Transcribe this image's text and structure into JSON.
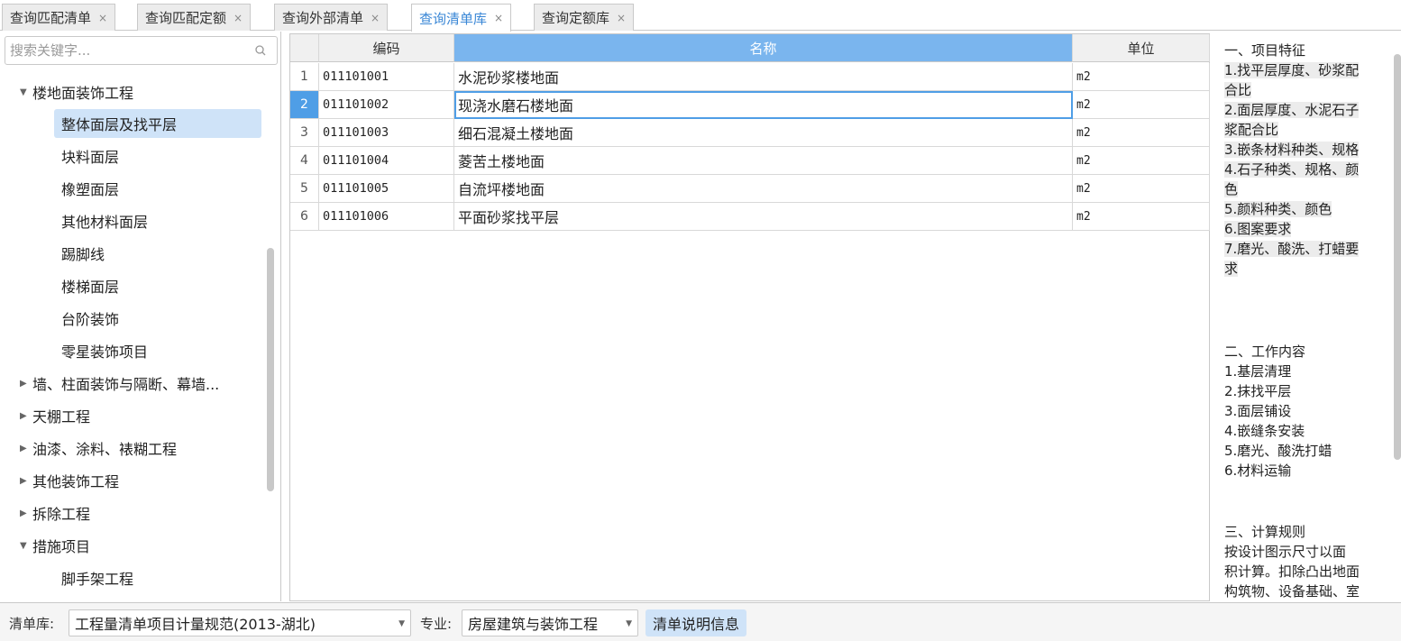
{
  "tabs": [
    {
      "label": "查询匹配清单",
      "active": false
    },
    {
      "label": "查询匹配定额",
      "active": false
    },
    {
      "label": "查询外部清单",
      "active": false
    },
    {
      "label": "查询清单库",
      "active": true
    },
    {
      "label": "查询定额库",
      "active": false
    }
  ],
  "close_glyph": "×",
  "search": {
    "placeholder": "搜索关键字..."
  },
  "tree": [
    {
      "label": "楼地面装饰工程",
      "expanded": true
    },
    {
      "label": "整体面层及找平层",
      "selected": true
    },
    {
      "label": "块料面层"
    },
    {
      "label": "橡塑面层"
    },
    {
      "label": "其他材料面层"
    },
    {
      "label": "踢脚线"
    },
    {
      "label": "楼梯面层"
    },
    {
      "label": "台阶装饰"
    },
    {
      "label": "零星装饰项目"
    },
    {
      "label": "墙、柱面装饰与隔断、幕墙...",
      "expanded": false
    },
    {
      "label": "天棚工程",
      "expanded": false
    },
    {
      "label": "油漆、涂料、裱糊工程",
      "expanded": false
    },
    {
      "label": "其他装饰工程",
      "expanded": false
    },
    {
      "label": "拆除工程",
      "expanded": false
    },
    {
      "label": "措施项目",
      "expanded": true
    },
    {
      "label": "脚手架工程"
    }
  ],
  "caret_expanded": "▼",
  "caret_collapsed": "▶",
  "grid": {
    "headers": {
      "code": "编码",
      "name": "名称",
      "unit": "单位"
    },
    "rows": [
      {
        "num": "1",
        "code": "011101001",
        "name": "水泥砂浆楼地面",
        "unit": "m2"
      },
      {
        "num": "2",
        "code": "011101002",
        "name": "现浇水磨石楼地面",
        "unit": "m2"
      },
      {
        "num": "3",
        "code": "011101003",
        "name": "细石混凝土楼地面",
        "unit": "m2"
      },
      {
        "num": "4",
        "code": "011101004",
        "name": "菱苦土楼地面",
        "unit": "m2"
      },
      {
        "num": "5",
        "code": "011101005",
        "name": "自流坪楼地面",
        "unit": "m2"
      },
      {
        "num": "6",
        "code": "011101006",
        "name": "平面砂浆找平层",
        "unit": "m2"
      }
    ],
    "selected_row": 1
  },
  "description": [
    {
      "text": "一、项目特征",
      "hl": false
    },
    {
      "text": "1.找平层厚度、砂浆配",
      "hl": true
    },
    {
      "text": "合比",
      "hl": true
    },
    {
      "text": "2.面层厚度、水泥石子",
      "hl": true
    },
    {
      "text": "浆配合比",
      "hl": true
    },
    {
      "text": "3.嵌条材料种类、规格",
      "hl": true
    },
    {
      "text": "4.石子种类、规格、颜",
      "hl": true
    },
    {
      "text": "色",
      "hl": true
    },
    {
      "text": "5.颜料种类、颜色",
      "hl": true
    },
    {
      "text": "6.图案要求",
      "hl": true
    },
    {
      "text": "7.磨光、酸洗、打蜡要",
      "hl": true
    },
    {
      "text": "求",
      "hl": true
    },
    {
      "text": "",
      "hl": false
    },
    {
      "text": "二、工作内容",
      "hl": false
    },
    {
      "text": "1.基层清理",
      "hl": false
    },
    {
      "text": "2.抹找平层",
      "hl": false
    },
    {
      "text": "3.面层铺设",
      "hl": false
    },
    {
      "text": "4.嵌缝条安装",
      "hl": false
    },
    {
      "text": "5.磨光、酸洗打蜡",
      "hl": false
    },
    {
      "text": "6.材料运输",
      "hl": false
    },
    {
      "text": "",
      "hl": false
    },
    {
      "text": "三、计算规则",
      "hl": false
    },
    {
      "text": " 按设计图示尺寸以面",
      "hl": false
    },
    {
      "text": "积计算。扣除凸出地面",
      "hl": false
    },
    {
      "text": "构筑物、设备基础、室",
      "hl": false
    }
  ],
  "bottom": {
    "library_label": "清单库:",
    "library_value": "工程量清单项目计量规范(2013-湖北)",
    "specialty_label": "专业:",
    "specialty_value": "房屋建筑与装饰工程",
    "info_button": "清单说明信息",
    "arrow_glyph": "▼"
  },
  "colors": {
    "accent": "#3a87d6",
    "selection": "#cfe3f8",
    "header_selected": "#7ab5ee"
  }
}
